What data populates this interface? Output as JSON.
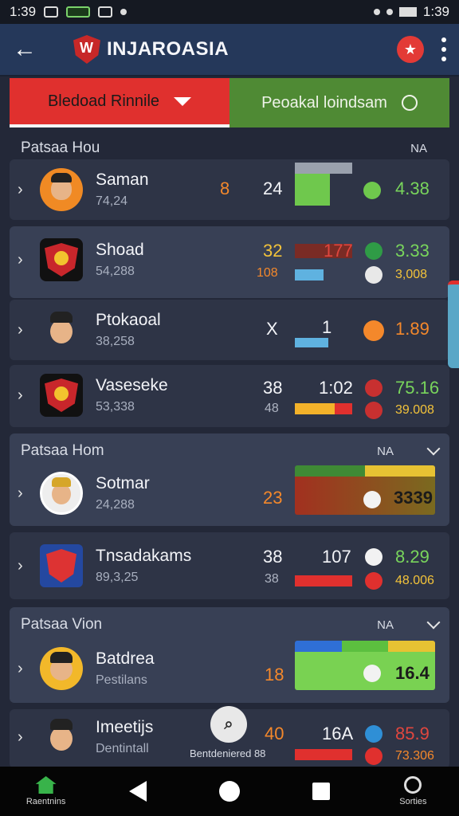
{
  "status": {
    "time": "1:39",
    "right_time": "1:39"
  },
  "appbar": {
    "title": "INJAROASIA"
  },
  "tabs": [
    {
      "label": "Bledoad Rinnile"
    },
    {
      "label": "Peoakal loindsam"
    }
  ],
  "sections": [
    {
      "title": "Patsaa Hou",
      "na": "NA"
    },
    {
      "title": "Patsaa Hom",
      "na": "NA"
    },
    {
      "title": "Patsaa Vion",
      "na": "NA"
    }
  ],
  "rows": [
    {
      "name": "Saman",
      "sub": "74,24",
      "a": "8",
      "b": "24",
      "score": "4.38"
    },
    {
      "name": "Shoad",
      "sub": "54,288",
      "a": "32",
      "a2": "108",
      "b": "177",
      "score": "3.33",
      "score2": "3,008"
    },
    {
      "name": "Ptokaoal",
      "sub": "38,258",
      "a": "X",
      "b": "1",
      "score": "1.89"
    },
    {
      "name": "Vaseseke",
      "sub": "53,338",
      "a": "38",
      "a2": "48",
      "b": "1:02",
      "score": "75.16",
      "score2": "39.008"
    },
    {
      "name": "Sotmar",
      "sub": "24,288",
      "a": "23",
      "score": "3339"
    },
    {
      "name": "Tnsadakams",
      "sub": "89,3,25",
      "a": "38",
      "a2": "38",
      "b": "107",
      "score": "8.29",
      "score2": "48.006"
    },
    {
      "name": "Batdrea",
      "sub": "Pestilans",
      "a": "18",
      "score": "16.4"
    },
    {
      "name": "Imeetijs",
      "sub": "Dentintall",
      "a": "40",
      "b": "16A",
      "score": "85.9",
      "score2": "73.306"
    }
  ],
  "fab": {
    "label": "Bentdeniered 88"
  },
  "nav": [
    {
      "label": "Raentnins"
    },
    {
      "label": ""
    },
    {
      "label": ""
    },
    {
      "label": ""
    },
    {
      "label": "Sorties"
    }
  ]
}
